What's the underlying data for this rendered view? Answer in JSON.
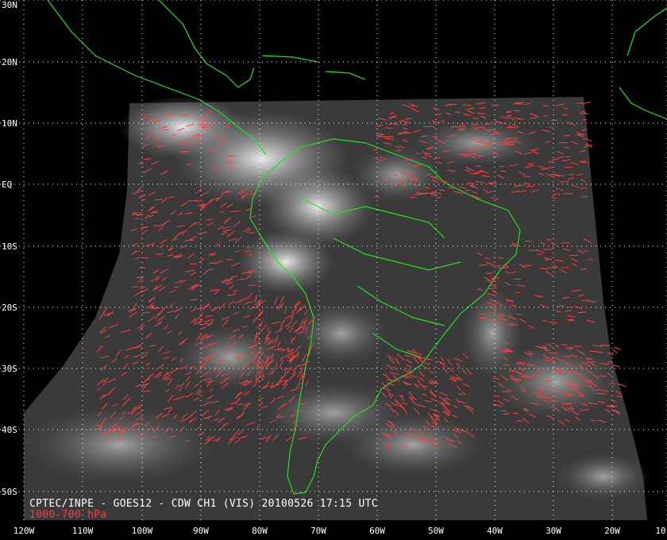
{
  "caption": {
    "line1": "CPTEC/INPE - GOES12 - CDW CH1 (VIS) 20100526 17:15 UTC",
    "line2": "1000-700 hPa"
  },
  "lat_labels": [
    "30N",
    "20N",
    "10N",
    "EQ",
    "10S",
    "20S",
    "30S",
    "40S",
    "50S"
  ],
  "lon_labels": [
    "120W",
    "110W",
    "100W",
    "90W",
    "80W",
    "70W",
    "60W",
    "50W",
    "40W",
    "30W",
    "20W",
    "10"
  ],
  "colors": {
    "coastline": "#22e022",
    "wind_vectors": "#ff4040",
    "grid": "#ffffff",
    "background": "#000000"
  },
  "icons": {
    "wind": "wind-barb-icon"
  }
}
